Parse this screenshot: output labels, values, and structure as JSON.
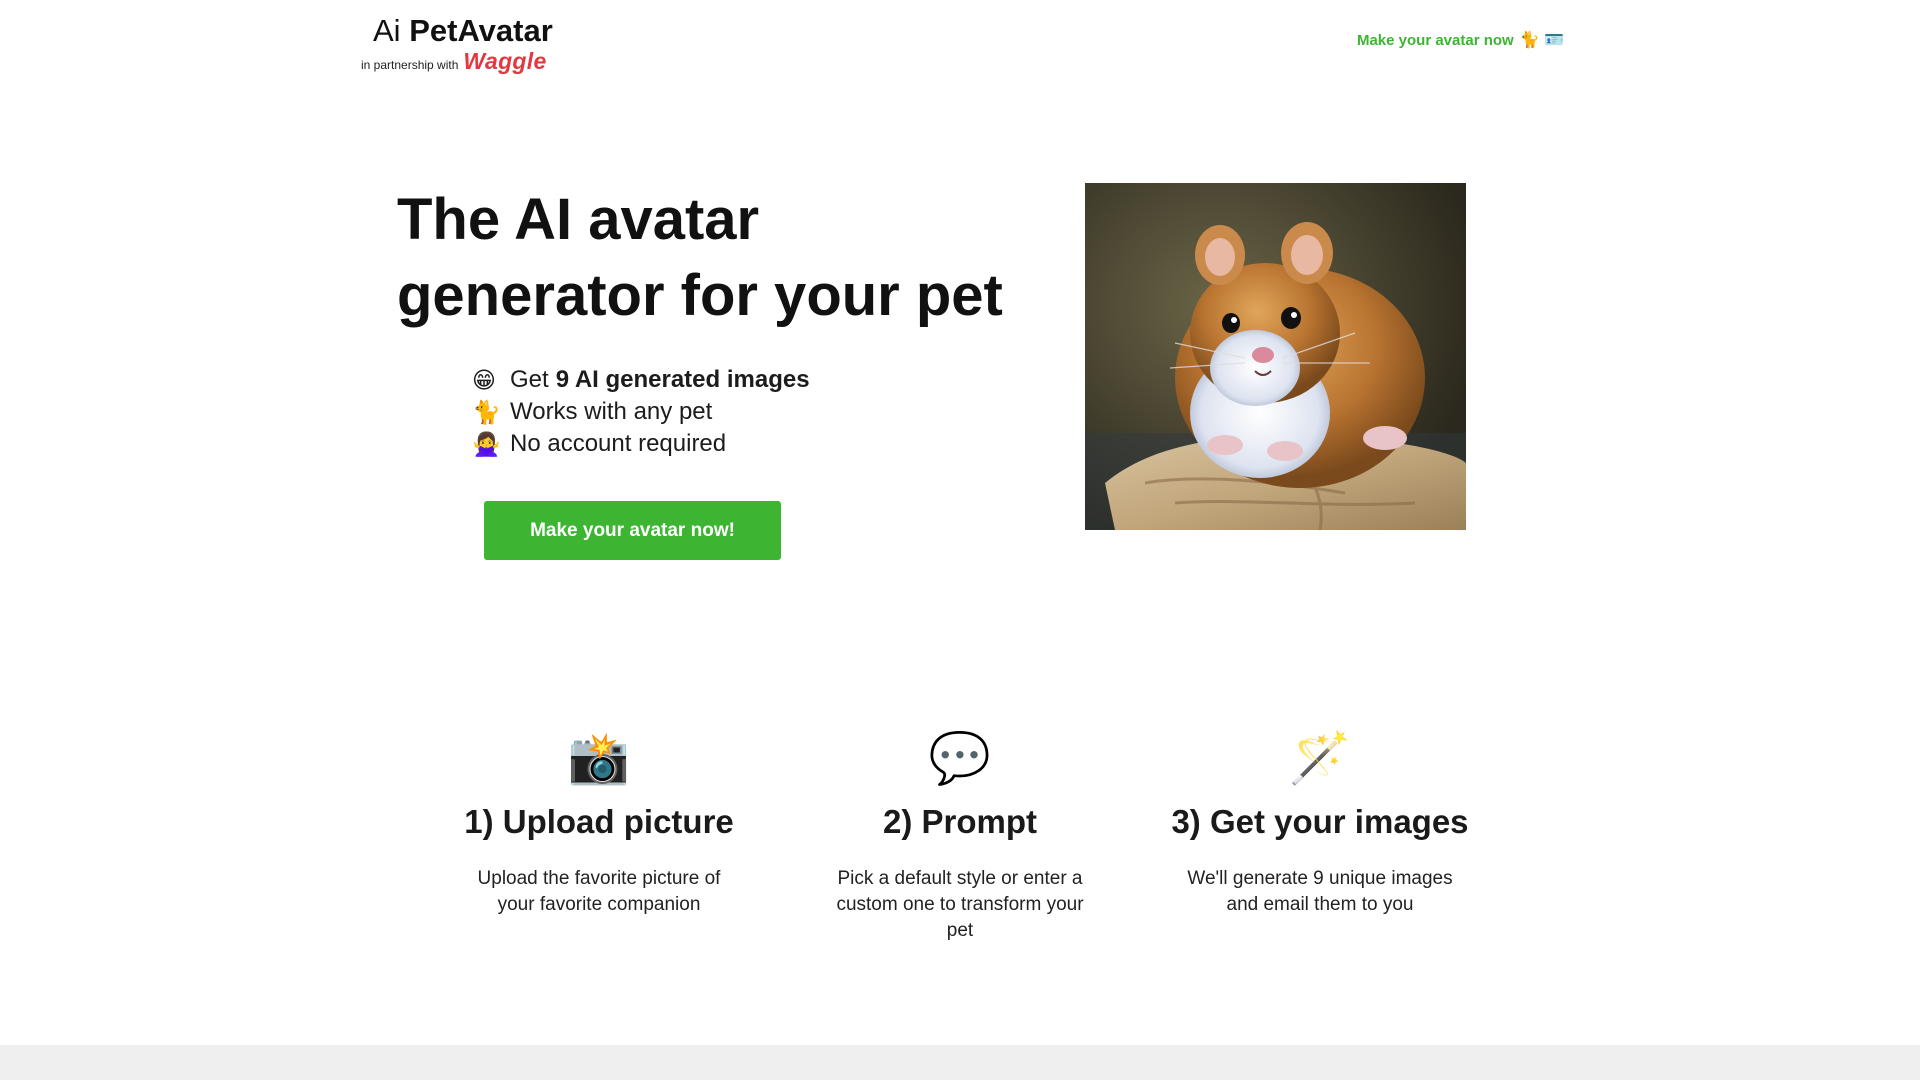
{
  "header": {
    "logo_ai": "Ai",
    "logo_name": "PetAvatar",
    "logo_partner": "in partnership with",
    "logo_waggle": "Waggle",
    "cta_label": "Make your avatar now",
    "cta_emojis": "🐈 🪪"
  },
  "hero": {
    "title": "The AI avatar generator for your pet",
    "features": [
      {
        "emoji": "😁",
        "text": "Get",
        "strong": "9 AI generated images"
      },
      {
        "emoji": "🐈",
        "text": "Works with any pet"
      },
      {
        "emoji": "🙅‍♀️",
        "text": "No account required"
      }
    ],
    "button_label": "Make your avatar now!"
  },
  "steps": [
    {
      "icon": "📸",
      "title": "1) Upload picture",
      "description": "Upload the favorite picture of your favorite companion"
    },
    {
      "icon": "💬",
      "title": "2) Prompt",
      "description": "Pick a default style or enter a custom one to transform your pet"
    },
    {
      "icon": "🪄",
      "title": "3) Get your images",
      "description": "We'll generate 9 unique images and email them to you"
    }
  ],
  "colors": {
    "accent_green": "#3db533",
    "waggle_red": "#e2383f",
    "footer_gray": "#efefef"
  }
}
